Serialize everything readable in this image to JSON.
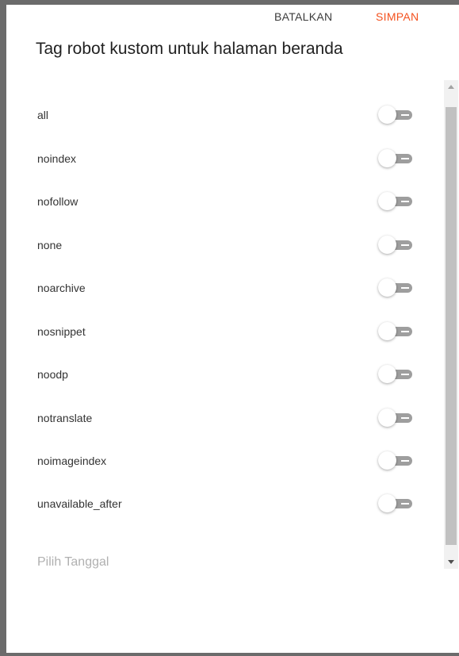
{
  "dialog": {
    "title": "Tag robot kustom untuk halaman beranda",
    "options": [
      {
        "label": "all",
        "enabled": false
      },
      {
        "label": "noindex",
        "enabled": false
      },
      {
        "label": "nofollow",
        "enabled": false
      },
      {
        "label": "none",
        "enabled": false
      },
      {
        "label": "noarchive",
        "enabled": false
      },
      {
        "label": "nosnippet",
        "enabled": false
      },
      {
        "label": "noodp",
        "enabled": false
      },
      {
        "label": "notranslate",
        "enabled": false
      },
      {
        "label": "noimageindex",
        "enabled": false
      },
      {
        "label": "unavailable_after",
        "enabled": false
      }
    ],
    "date_placeholder": "Pilih Tanggal",
    "cancel_label": "BATALKAN",
    "save_label": "SIMPAN"
  },
  "colors": {
    "accent": "#f4511e",
    "toggle_track_off": "#9e9e9e",
    "backdrop": "#6b6b6b"
  }
}
